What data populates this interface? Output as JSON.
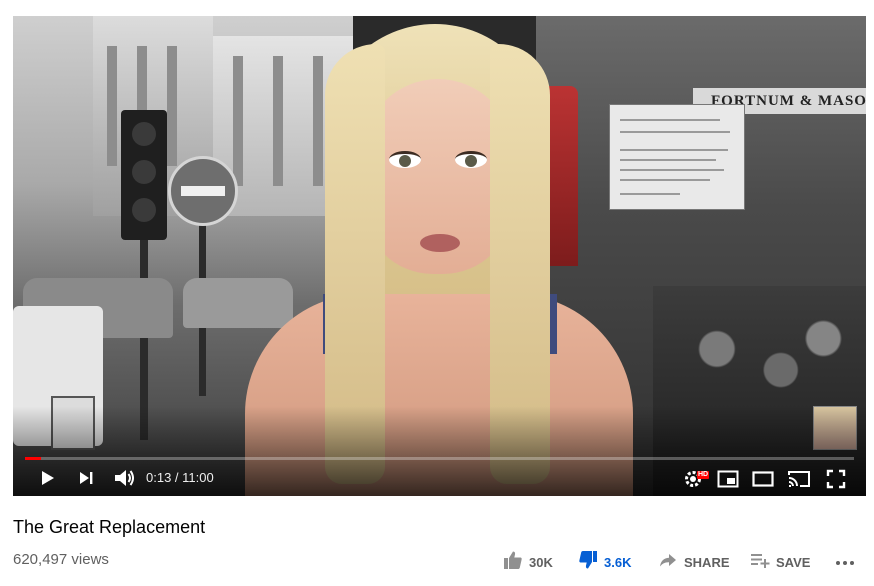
{
  "video": {
    "title": "The Great Replacement",
    "views": "620,497 views",
    "scene_sign": "FORTNUM & MASON"
  },
  "player": {
    "time_display": "0:13 / 11:00",
    "progress_fraction": 0.0197,
    "hd_badge": "HD",
    "icons": [
      "play-icon",
      "next-icon",
      "volume-icon",
      "settings-icon",
      "miniplayer-icon",
      "theater-icon",
      "cast-icon",
      "fullscreen-icon"
    ]
  },
  "actions": {
    "like_count": "30K",
    "dislike_count": "3.6K",
    "share_label": "SHARE",
    "save_label": "SAVE",
    "more_icon": "more-horiz-icon"
  },
  "colors": {
    "progress": "#ff0000",
    "dislike_active": "#065fd4",
    "secondary_text": "#606060",
    "primary_text": "#030303"
  }
}
